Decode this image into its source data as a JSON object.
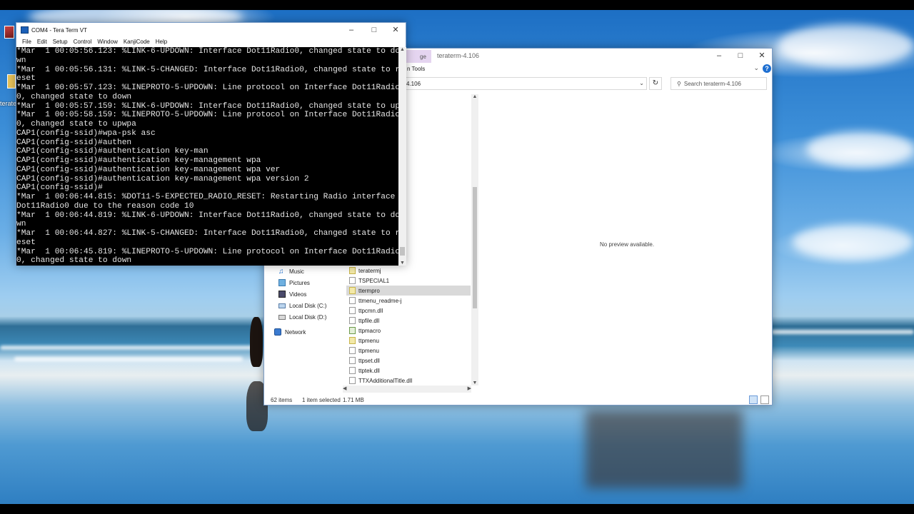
{
  "desktop": {
    "icon_label": "terate"
  },
  "teraterm": {
    "title": "COM4 - Tera Term VT",
    "menu": [
      "File",
      "Edit",
      "Setup",
      "Control",
      "Window",
      "KanjiCode",
      "Help"
    ],
    "console_lines": [
      "*Mar  1 00:05:56.123: %LINK-6-UPDOWN: Interface Dot11Radio0, changed state to do",
      "wn",
      "*Mar  1 00:05:56.131: %LINK-5-CHANGED: Interface Dot11Radio0, changed state to r",
      "eset",
      "*Mar  1 00:05:57.123: %LINEPROTO-5-UPDOWN: Line protocol on Interface Dot11Radio",
      "0, changed state to down",
      "*Mar  1 00:05:57.159: %LINK-6-UPDOWN: Interface Dot11Radio0, changed state to up",
      "*Mar  1 00:05:58.159: %LINEPROTO-5-UPDOWN: Line protocol on Interface Dot11Radio",
      "0, changed state to upwpa",
      "CAP1(config-ssid)#wpa-psk asc",
      "CAP1(config-ssid)#authen",
      "CAP1(config-ssid)#authentication key-man",
      "CAP1(config-ssid)#authentication key-management wpa",
      "CAP1(config-ssid)#authentication key-management wpa ver",
      "CAP1(config-ssid)#authentication key-management wpa version 2",
      "CAP1(config-ssid)#",
      "*Mar  1 00:06:44.815: %DOT11-5-EXPECTED_RADIO_RESET: Restarting Radio interface",
      "Dot11Radio0 due to the reason code 10",
      "*Mar  1 00:06:44.819: %LINK-6-UPDOWN: Interface Dot11Radio0, changed state to do",
      "wn",
      "*Mar  1 00:06:44.827: %LINK-5-CHANGED: Interface Dot11Radio0, changed state to r",
      "eset",
      "*Mar  1 00:06:45.819: %LINEPROTO-5-UPDOWN: Line protocol on Interface Dot11Radio",
      "0, changed state to down"
    ]
  },
  "explorer": {
    "title": "teraterm-4.106",
    "ribbon_tab": "ge",
    "ribbon_tools": "n Tools",
    "address": "4.106",
    "search_placeholder": "Search teraterm-4.106",
    "nav_items": [
      {
        "label": "Music",
        "icon": "music-icon"
      },
      {
        "label": "Pictures",
        "icon": "pictures-icon"
      },
      {
        "label": "Videos",
        "icon": "videos-icon"
      },
      {
        "label": "Local Disk (C:)",
        "icon": "drive-icon"
      },
      {
        "label": "Local Disk (D:)",
        "icon": "drive-icon"
      },
      {
        "label": "Network",
        "icon": "network-icon"
      }
    ],
    "files": [
      {
        "name": "teratermj",
        "icon": "yellow"
      },
      {
        "name": "TSPECIAL1",
        "icon": "plain"
      },
      {
        "name": "ttermpro",
        "icon": "yellow",
        "selected": true
      },
      {
        "name": "ttmenu_readme-j",
        "icon": "plain"
      },
      {
        "name": "ttpcmn.dll",
        "icon": "plain"
      },
      {
        "name": "ttpfile.dll",
        "icon": "plain"
      },
      {
        "name": "ttpmacro",
        "icon": "green"
      },
      {
        "name": "ttpmenu",
        "icon": "yellow"
      },
      {
        "name": "ttpmenu",
        "icon": "plain"
      },
      {
        "name": "ttpset.dll",
        "icon": "plain"
      },
      {
        "name": "ttptek.dll",
        "icon": "plain"
      },
      {
        "name": "TTXAdditionalTitle.dll",
        "icon": "plain"
      }
    ],
    "preview_text": "No preview available.",
    "status": {
      "item_count": "62 items",
      "selection": "1 item selected",
      "size": "1.71 MB"
    }
  }
}
